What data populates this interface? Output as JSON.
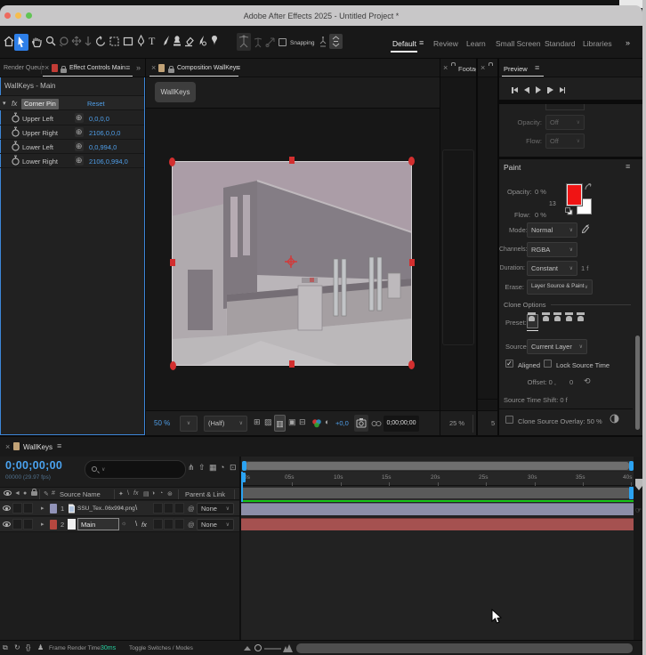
{
  "window": {
    "title": "Adobe After Effects 2025 - Untitled Project *"
  },
  "toolbar": {
    "snapping_label": "Snapping",
    "workspaces": [
      "Default",
      "Review",
      "Learn",
      "Small Screen",
      "Standard",
      "Libraries"
    ],
    "overflow_glyph": "»"
  },
  "glyphs": {
    "menu": "≡",
    "close": "×",
    "chevron": "∨",
    "expand": "▸",
    "at": "@",
    "target": "⊕",
    "fx": "fx",
    "backslash": "\\",
    "hash": "#",
    "reset": "⟲",
    "collapse": "☼",
    "pin": "✧"
  },
  "effect_controls": {
    "tab_inactive": "Render Queue",
    "tab_active": "Effect Controls Main",
    "comp_ref": "WallKeys - Main",
    "effect_name": "Corner Pin",
    "reset_label": "Reset",
    "params": [
      {
        "label": "Upper Left",
        "value": "0,0,0,0"
      },
      {
        "label": "Upper Right",
        "value": "2106,0,0,0"
      },
      {
        "label": "Lower Left",
        "value": "0,0,994,0"
      },
      {
        "label": "Lower Right",
        "value": "2106,0,994,0"
      }
    ]
  },
  "composition": {
    "tab": "Composition WallKeys",
    "button": "WallKeys",
    "zoom": "50 %",
    "resolution": "(Half)",
    "offset": "+0,0",
    "timecode": "0;00;00;00"
  },
  "footage": {
    "tab": "Footag",
    "zoom": "25 %"
  },
  "viewer2": {
    "zoom": "5"
  },
  "preview": {
    "title": "Preview"
  },
  "brushes": {
    "rows": [
      {
        "label": "Opacity:",
        "value": "Off"
      },
      {
        "label": "Flow:",
        "value": "Off"
      }
    ]
  },
  "paint": {
    "title": "Paint",
    "opacity_label": "Opacity:",
    "opacity_value": "0 %",
    "flow_label": "Flow:",
    "flow_value": "0 %",
    "brush_size": "13",
    "mode_label": "Mode:",
    "mode_value": "Normal",
    "channels_label": "Channels:",
    "channels_value": "RGBA",
    "duration_label": "Duration:",
    "duration_value": "Constant",
    "duration_unit": "1 f",
    "erase_label": "Erase:",
    "erase_value": "Layer Source & Paint",
    "clone_options_label": "Clone Options",
    "preset_label": "Preset:",
    "source_label": "Source:",
    "source_value": "Current Layer",
    "aligned_label": "Aligned",
    "lock_source_label": "Lock Source Time",
    "offset_label": "Offset: 0 ,",
    "offset_value": "0",
    "source_time_shift": "Source Time Shift: 0 f",
    "overlay_label": "Clone Source Overlay: 50 %"
  },
  "timeline": {
    "tab": "WallKeys",
    "timecode": "0;00;00;00",
    "frame_info": "00000 (29.97 fps)",
    "source_name_col": "Source Name",
    "parent_link_col": "Parent & Link",
    "layers": [
      {
        "num": "1",
        "name": "SSU_Tex..06x994.png",
        "parent": "None"
      },
      {
        "num": "2",
        "name": "Main",
        "parent": "None"
      }
    ],
    "ruler": [
      "0s",
      "05s",
      "10s",
      "15s",
      "20s",
      "25s",
      "30s",
      "35s",
      "40s"
    ]
  },
  "status_bar": {
    "frame_render_label": "Frame Render Time:",
    "frame_render_value": "30ms",
    "toggle_label": "Toggle Switches / Modes"
  }
}
